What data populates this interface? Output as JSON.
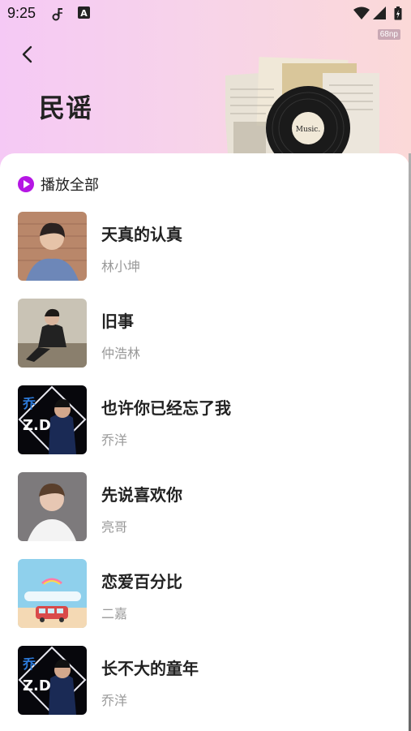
{
  "status": {
    "time": "9:25",
    "fps": "68np"
  },
  "header": {
    "title": "民谣",
    "collage_text": "Music."
  },
  "play_all": {
    "label": "播放全部"
  },
  "songs": [
    {
      "title": "天真的认真",
      "artist": "林小坤"
    },
    {
      "title": "旧事",
      "artist": "仲浩林"
    },
    {
      "title": "也许你已经忘了我",
      "artist": "乔洋"
    },
    {
      "title": "先说喜欢你",
      "artist": "亮哥"
    },
    {
      "title": "恋爱百分比",
      "artist": "二嘉"
    },
    {
      "title": "长不大的童年",
      "artist": "乔洋"
    }
  ],
  "colors": {
    "accent": "#b516e4",
    "header_left": "#f5c9f5",
    "header_right": "#fbd9d8"
  }
}
